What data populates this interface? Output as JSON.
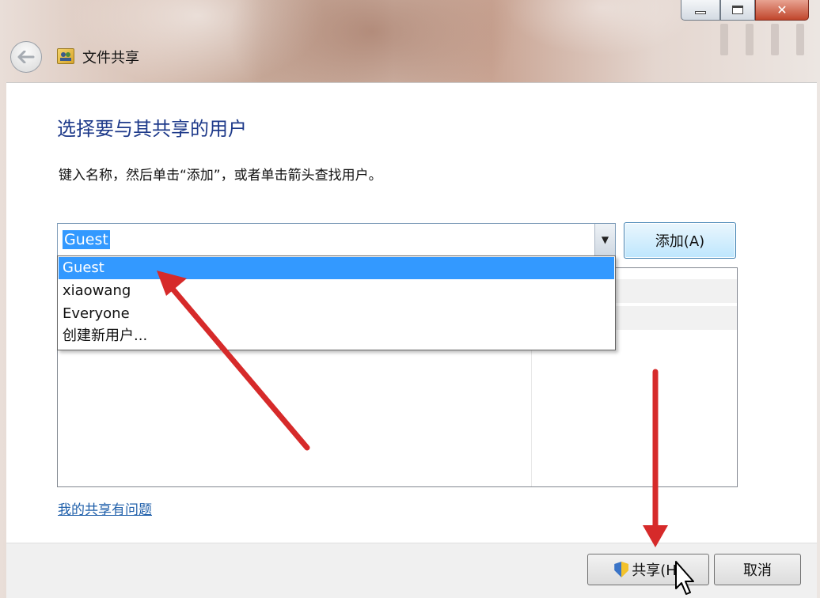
{
  "window": {
    "title": "文件共享",
    "caption": {
      "minimize": "",
      "maximize": "",
      "close": "✕"
    }
  },
  "nav": {
    "back_symbol": "↔"
  },
  "main": {
    "heading": "选择要与其共享的用户",
    "instruction": "键入名称，然后单击“添加”，或者单击箭头查找用户。",
    "combo": {
      "value": "Guest",
      "options": [
        "Guest",
        "xiaowang",
        "Everyone",
        "创建新用户..."
      ],
      "selected_index": 0
    },
    "add_button": "添加(A)",
    "help_link": "我的共享有问题"
  },
  "footer": {
    "share_button": "共享(H)",
    "cancel_button": "取消"
  },
  "colors": {
    "heading": "#1e3a8a",
    "selection": "#3399ff",
    "annotation_arrow": "#d62a2a",
    "link": "#1f5faa"
  },
  "icons": [
    "back-arrow-icon",
    "file-sharing-icon",
    "dropdown-arrow-icon",
    "uac-shield-icon",
    "mouse-cursor-icon",
    "minimize-icon",
    "maximize-icon",
    "close-icon"
  ]
}
